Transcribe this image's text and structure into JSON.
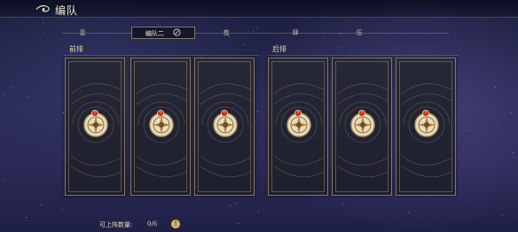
{
  "header": {
    "title": "编队"
  },
  "tabs": [
    {
      "label": "壹",
      "active": false
    },
    {
      "label": "编队二",
      "active": true
    },
    {
      "label": "叁",
      "active": false
    },
    {
      "label": "肆",
      "active": false
    },
    {
      "label": "伍",
      "active": false
    }
  ],
  "sections": {
    "front": "前排",
    "back": "后排"
  },
  "slots": [
    {
      "row": "front",
      "state": "empty",
      "badge": "!"
    },
    {
      "row": "front",
      "state": "empty",
      "badge": "!"
    },
    {
      "row": "front",
      "state": "empty",
      "badge": "!"
    },
    {
      "row": "back",
      "state": "empty",
      "badge": "!"
    },
    {
      "row": "back",
      "state": "empty",
      "badge": "!"
    },
    {
      "row": "back",
      "state": "empty",
      "badge": "!"
    }
  ],
  "footer": {
    "count_label": "可上阵数量:",
    "count_value": "0/6",
    "info_symbol": "!"
  },
  "icons": {
    "back": "back-arrow-icon",
    "edit": "edit-icon",
    "slot": "emblem-icon",
    "info": "info-icon"
  },
  "colors": {
    "frame": "#8b7a55",
    "badge": "#c8281c",
    "gold": "#d8b660",
    "background": "#2a2b55"
  }
}
